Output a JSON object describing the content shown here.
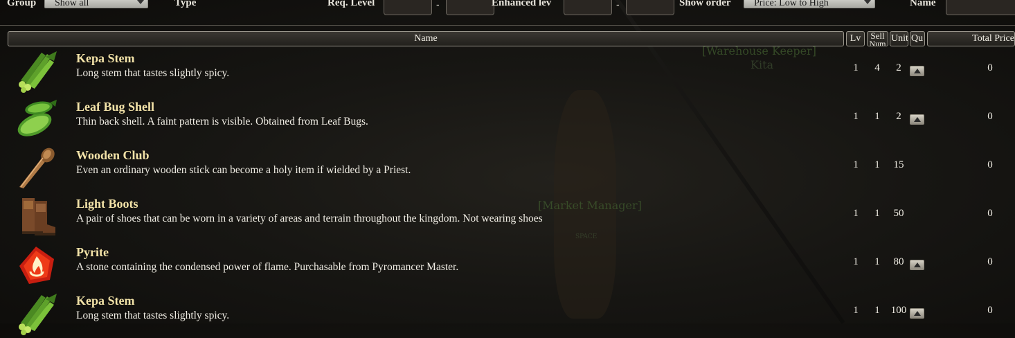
{
  "filters": {
    "group_label": "Group",
    "group_value": "Show all",
    "type_label": "Type",
    "req_level_label": "Req. Level",
    "req_level_dash": "-",
    "enhanced_label": "Enhanced lev",
    "enhanced_dash": "-",
    "show_order_label": "Show order",
    "show_order_value": "Price: Low to High",
    "name_label": "Name"
  },
  "table": {
    "headers": {
      "name": "Name",
      "lv": "Lv",
      "sell": "Sell",
      "sell_sub": "Num",
      "unit": "Unit",
      "qty": "Qu",
      "total": "Total Price"
    },
    "rows": [
      {
        "name": "Kepa Stem",
        "desc": "Long stem that tastes slightly spicy.",
        "lv": "1",
        "sell": "4",
        "unit": "2",
        "qty_button": true,
        "total": "0",
        "icon": "kepa-stem-icon"
      },
      {
        "name": "Leaf Bug Shell",
        "desc": "Thin back shell. A faint pattern is visible. Obtained from Leaf Bugs.",
        "lv": "1",
        "sell": "1",
        "unit": "2",
        "qty_button": true,
        "total": "0",
        "icon": "leaf-bug-shell-icon"
      },
      {
        "name": "Wooden Club",
        "desc": "Even an ordinary wooden stick can become a holy item if wielded by a Priest.",
        "lv": "1",
        "sell": "1",
        "unit": "15",
        "qty_button": false,
        "total": "0",
        "icon": "wooden-club-icon"
      },
      {
        "name": "Light Boots",
        "desc": "A pair of shoes that can be worn in a variety of areas and terrain throughout the kingdom. Not wearing shoes",
        "lv": "1",
        "sell": "1",
        "unit": "50",
        "qty_button": false,
        "total": "0",
        "icon": "light-boots-icon"
      },
      {
        "name": "Pyrite",
        "desc": "A stone containing the condensed power of flame. Purchasable from Pyromancer Master.",
        "lv": "1",
        "sell": "1",
        "unit": "80",
        "qty_button": true,
        "total": "0",
        "icon": "pyrite-icon"
      },
      {
        "name": "Kepa Stem",
        "desc": "Long stem that tastes slightly spicy.",
        "lv": "1",
        "sell": "1",
        "unit": "100",
        "qty_button": true,
        "total": "0",
        "icon": "kepa-stem-icon"
      }
    ]
  },
  "background": {
    "npc_1_title": "[Warehouse Keeper]",
    "npc_1_name": "Kita",
    "npc_2_title": "[Market Manager]",
    "npc_2_sub": "SPACE"
  },
  "colors": {
    "item_name": "#f3e3a8",
    "text": "#f0ede4",
    "background": "#171613"
  }
}
